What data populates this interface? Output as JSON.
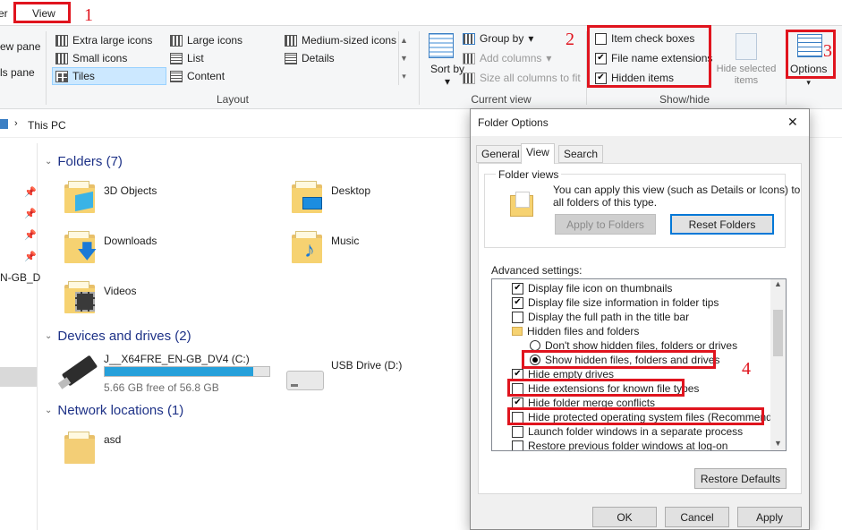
{
  "ribbon": {
    "tab_prev": "er",
    "tab_view": "View",
    "nav_pane_1": "ew pane",
    "nav_pane_2": "ls pane",
    "layout": {
      "label": "Layout",
      "items": [
        "Extra large icons",
        "Large icons",
        "Medium-sized icons",
        "Small icons",
        "List",
        "Details",
        "Tiles",
        "Content"
      ],
      "selected": "Tiles"
    },
    "current_view": {
      "label": "Current view",
      "sort_by": "Sort by",
      "group_by": "Group by",
      "add_columns": "Add columns",
      "size_all_columns": "Size all columns to fit"
    },
    "show_hide": {
      "label": "Show/hide",
      "item_check_boxes": {
        "label": "Item check boxes",
        "checked": false
      },
      "file_name_extensions": {
        "label": "File name extensions",
        "checked": true
      },
      "hidden_items": {
        "label": "Hidden items",
        "checked": true
      },
      "hide_selected_line1": "Hide selected",
      "hide_selected_line2": "items",
      "options": "Options"
    }
  },
  "annotations": {
    "n1": "1",
    "n2": "2",
    "n3": "3",
    "n4": "4"
  },
  "address": {
    "location": "This PC"
  },
  "left_nav": {
    "partial_item": "N-GB_D"
  },
  "sections": {
    "folders": {
      "header": "Folders (7)",
      "items": [
        "3D Objects",
        "Desktop",
        "Downloads",
        "Music",
        "Videos"
      ]
    },
    "devices": {
      "header": "Devices and drives (2)",
      "drive_c_name": "J__X64FRE_EN-GB_DV4 (C:)",
      "drive_c_free": "5.66 GB free of 56.8 GB",
      "drive_c_used_fraction": 0.9,
      "drive_d_name": "USB Drive (D:)"
    },
    "network": {
      "header": "Network locations (1)",
      "items": [
        "asd"
      ]
    }
  },
  "dialog": {
    "title": "Folder Options",
    "close": "✕",
    "tabs": [
      "General",
      "View",
      "Search"
    ],
    "active_tab": "View",
    "folder_views_legend": "Folder views",
    "folder_views_text_1": "You can apply this view (such as Details or Icons) to",
    "folder_views_text_2": "all folders of this type.",
    "apply_to_folders": "Apply to Folders",
    "reset_folders": "Reset Folders",
    "advanced_label": "Advanced settings:",
    "advanced": [
      {
        "kind": "check",
        "label": "Display file icon on thumbnails",
        "checked": true
      },
      {
        "kind": "check",
        "label": "Display file size information in folder tips",
        "checked": true
      },
      {
        "kind": "check",
        "label": "Display the full path in the title bar",
        "checked": false
      },
      {
        "kind": "folder",
        "label": "Hidden files and folders"
      },
      {
        "kind": "radio",
        "label": "Don't show hidden files, folders or drives",
        "checked": false
      },
      {
        "kind": "radio",
        "label": "Show hidden files, folders and drives",
        "checked": true
      },
      {
        "kind": "check",
        "label": "Hide empty drives",
        "checked": true
      },
      {
        "kind": "check",
        "label": "Hide extensions for known file types",
        "checked": false
      },
      {
        "kind": "check",
        "label": "Hide folder merge conflicts",
        "checked": true
      },
      {
        "kind": "check",
        "label": "Hide protected operating system files (Recommended)",
        "checked": false
      },
      {
        "kind": "check",
        "label": "Launch folder windows in a separate process",
        "checked": false
      },
      {
        "kind": "check",
        "label": "Restore previous folder windows at log-on",
        "checked": false
      }
    ],
    "restore_defaults": "Restore Defaults",
    "ok": "OK",
    "cancel": "Cancel",
    "apply": "Apply"
  },
  "colors": {
    "annotation_red": "#e0141e",
    "link_blue": "#1e3287",
    "drive_bar": "#26a0da"
  }
}
